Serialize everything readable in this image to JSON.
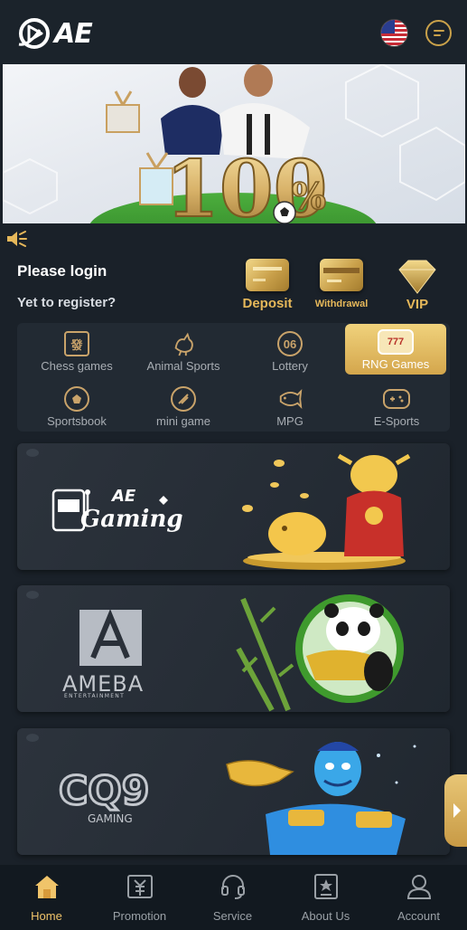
{
  "header": {
    "logo_text": "AE",
    "flag": "us-flag-icon",
    "chat": "chat-icon"
  },
  "banner": {
    "promo_text": "100%",
    "percent_sign": "%"
  },
  "notice": {
    "icon": "speaker-icon"
  },
  "account": {
    "login_text": "Please login",
    "register_text": "Yet to register?"
  },
  "wallet": [
    {
      "label": "Deposit",
      "icon": "deposit-card-icon"
    },
    {
      "label": "Withdrawal",
      "icon": "withdrawal-card-icon"
    },
    {
      "label": "VIP",
      "icon": "vip-diamond-icon"
    }
  ],
  "categories": [
    {
      "label": "Chess games",
      "icon": "mahjong-tile-icon",
      "glyph": "發"
    },
    {
      "label": "Animal Sports",
      "icon": "rooster-icon",
      "glyph": ""
    },
    {
      "label": "Lottery",
      "icon": "lottery-ball-icon",
      "glyph": "06"
    },
    {
      "label": "RNG Games",
      "icon": "slot-777-icon",
      "glyph": "777",
      "active": true
    },
    {
      "label": "Sportsbook",
      "icon": "soccer-ball-icon",
      "glyph": ""
    },
    {
      "label": "mini game",
      "icon": "mini-game-icon",
      "glyph": ""
    },
    {
      "label": "MPG",
      "icon": "fish-icon",
      "glyph": ""
    },
    {
      "label": "E-Sports",
      "icon": "gamepad-icon",
      "glyph": ""
    }
  ],
  "providers": [
    {
      "name": "AE Gaming",
      "logo_main": "AE",
      "logo_sub": "Gaming"
    },
    {
      "name": "AMEBA",
      "logo_main": "AMEBA",
      "logo_sub": "ENTERTAINMENT"
    },
    {
      "name": "CQ9",
      "logo_main": "CQ9",
      "logo_sub": "GAMING"
    }
  ],
  "nav": [
    {
      "label": "Home",
      "icon": "home-icon",
      "active": true
    },
    {
      "label": "Promotion",
      "icon": "promotion-icon"
    },
    {
      "label": "Service",
      "icon": "headset-icon"
    },
    {
      "label": "About Us",
      "icon": "about-icon"
    },
    {
      "label": "Account",
      "icon": "account-icon"
    }
  ],
  "colors": {
    "background": "#1a2129",
    "accent_gold": "#e6b85a",
    "nav_active": "#f0c46a"
  }
}
